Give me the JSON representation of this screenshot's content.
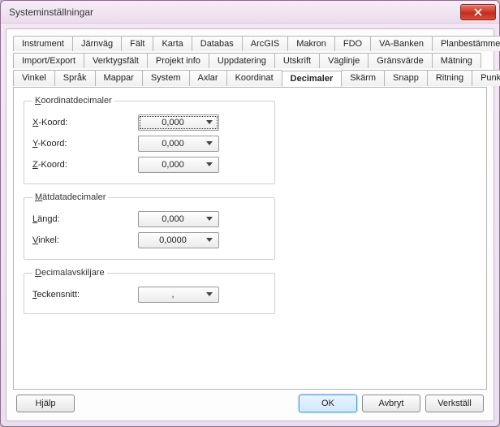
{
  "window": {
    "title": "Systeminställningar"
  },
  "tabs": {
    "row1": [
      "Instrument",
      "Järnväg",
      "Fält",
      "Karta",
      "Databas",
      "ArcGIS",
      "Makron",
      "FDO",
      "VA-Banken",
      "Planbestämmelser"
    ],
    "row2": [
      "Import/Export",
      "Verktygsfält",
      "Projekt info",
      "Uppdatering",
      "Utskrift",
      "Väglinje",
      "Gränsvärde",
      "Mätning"
    ],
    "row3": [
      "Vinkel",
      "Språk",
      "Mappar",
      "System",
      "Axlar",
      "Koordinat",
      "Decimaler",
      "Skärm",
      "Snapp",
      "Ritning",
      "Punktinfo"
    ],
    "active": "Decimaler"
  },
  "groups": {
    "koord": {
      "legend_pre": "K",
      "legend_rest": "oordinatdecimaler",
      "x": {
        "label_pre": "X",
        "label_rest": "-Koord:",
        "value": "0,000"
      },
      "y": {
        "label_pre": "Y",
        "label_rest": "-Koord:",
        "value": "0,000"
      },
      "z": {
        "label_pre": "Z",
        "label_rest": "-Koord:",
        "value": "0,000"
      }
    },
    "mat": {
      "legend_pre": "M",
      "legend_rest": "ätdatadecimaler",
      "langd": {
        "label_pre": "L",
        "label_rest": "ängd:",
        "value": "0,000"
      },
      "vinkel": {
        "label_pre": "V",
        "label_rest": "inkel:",
        "value": "0,0000"
      }
    },
    "dec": {
      "legend_pre": "D",
      "legend_rest": "ecimalavskiljare",
      "teck": {
        "label_pre": "T",
        "label_rest": "eckensnitt:",
        "value": ","
      }
    }
  },
  "buttons": {
    "help": "Hjälp",
    "ok": "OK",
    "cancel": "Avbryt",
    "apply": "Verkställ"
  }
}
